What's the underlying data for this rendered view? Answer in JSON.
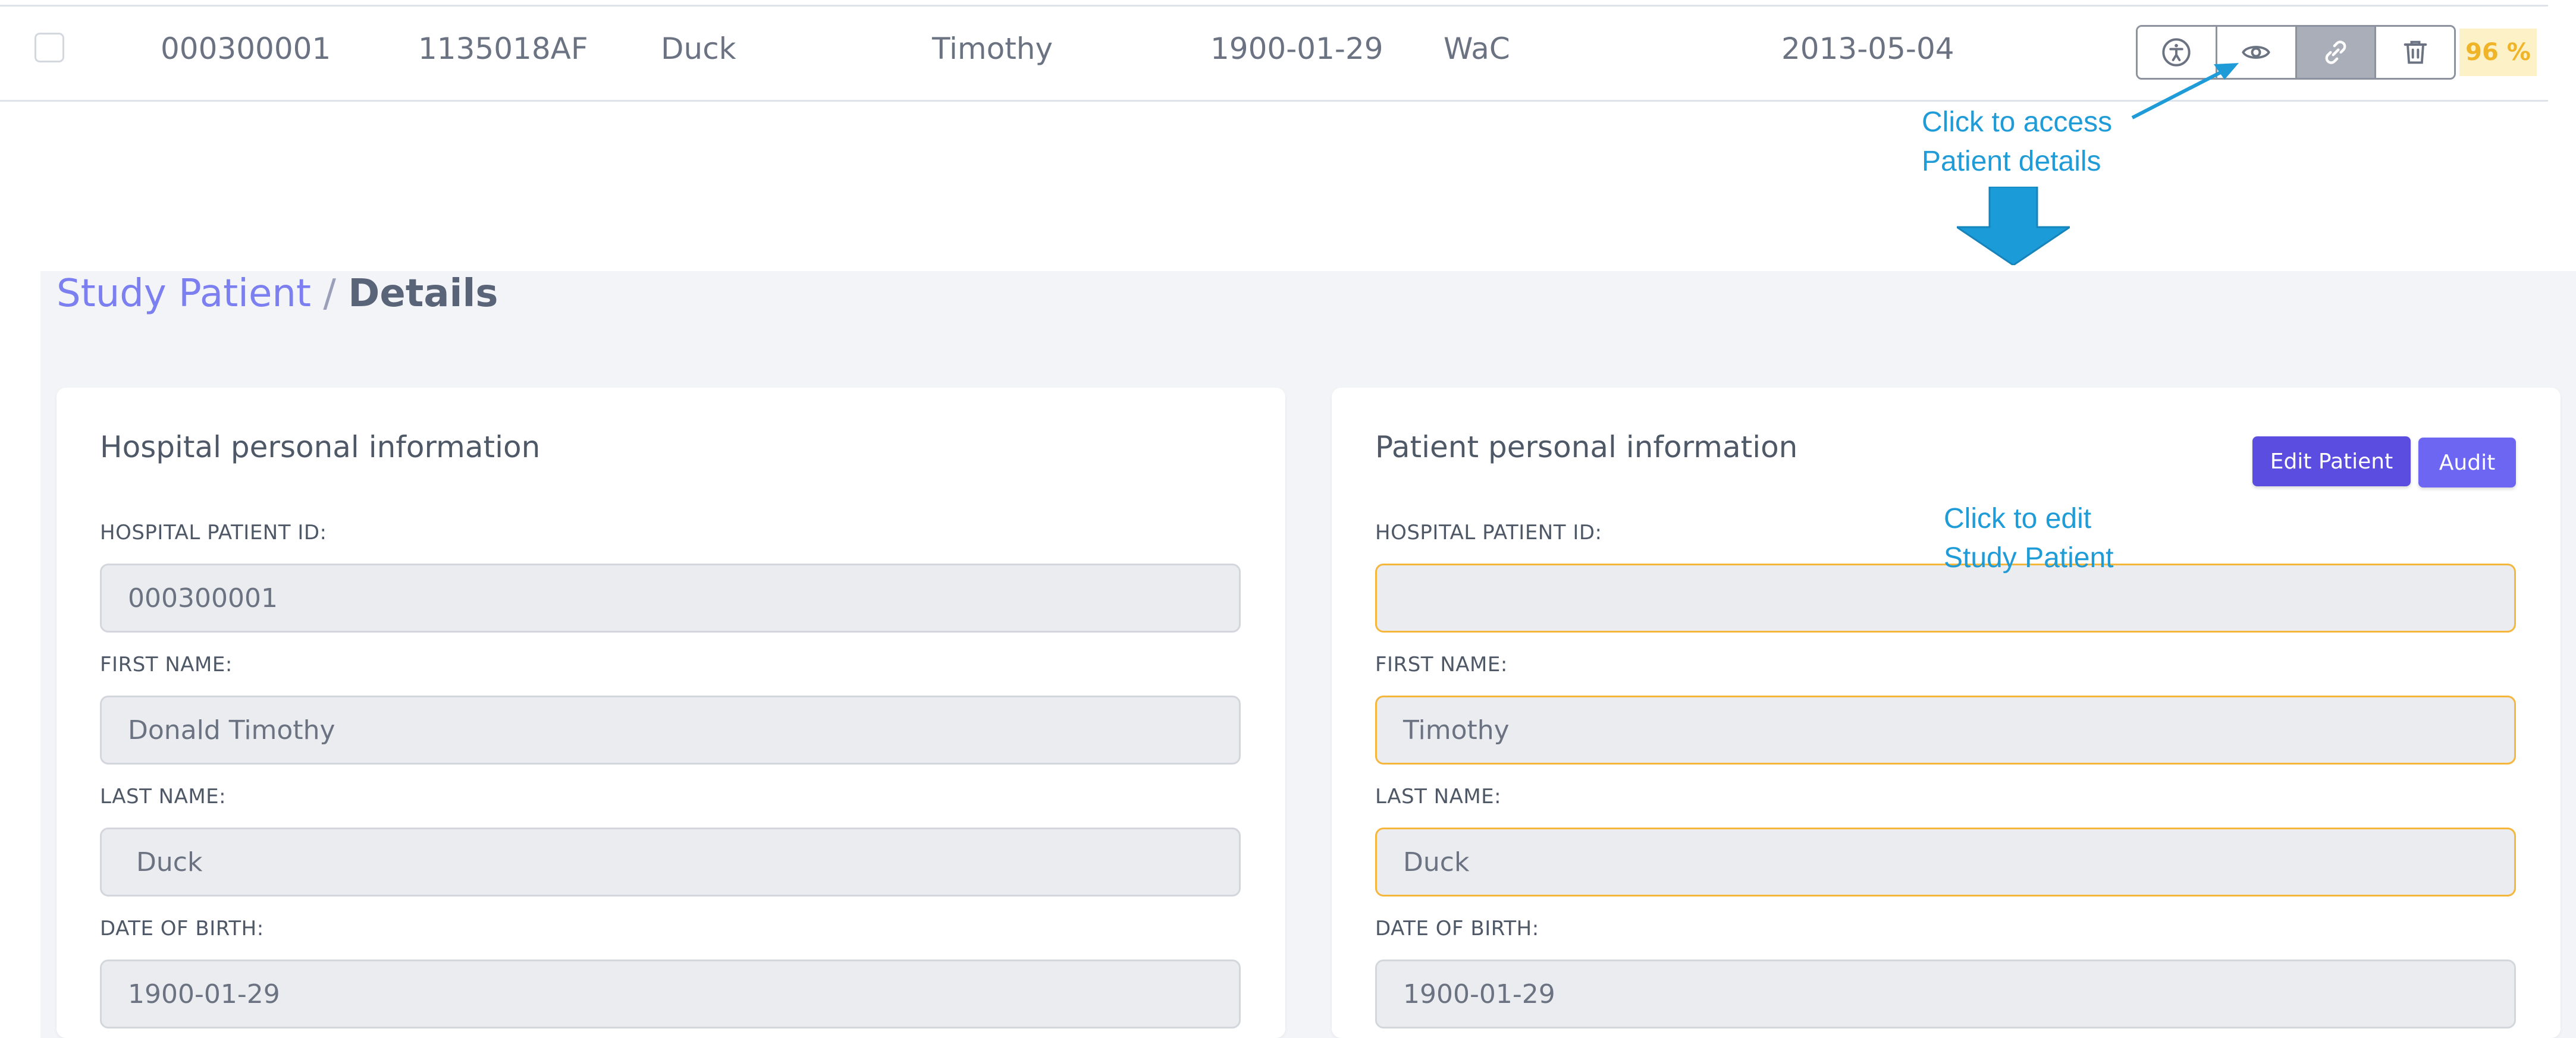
{
  "table_row": {
    "hospital_patient_id": "000300001",
    "study_id": "1135018AF",
    "last_name": "Duck",
    "first_name": "Timothy",
    "date_of_birth": "1900-01-29",
    "site": "WaC",
    "date": "2013-05-04",
    "actions": [
      "accessibility-icon",
      "eye-icon",
      "link-icon",
      "trash-icon"
    ],
    "score": "96 %"
  },
  "annotations": {
    "access_line1": "Click to access",
    "access_line2": "Patient details",
    "edit_line1": "Click to edit",
    "edit_line2": "Study Patient"
  },
  "breadcrumb": {
    "parent": "Study Patient",
    "separator": "/",
    "current": "Details"
  },
  "hospital_card": {
    "title": "Hospital personal information",
    "fields": [
      {
        "label": "HOSPITAL PATIENT ID:",
        "value": "000300001"
      },
      {
        "label": "FIRST NAME:",
        "value": "Donald Timothy"
      },
      {
        "label": "LAST NAME:",
        "value": " Duck"
      },
      {
        "label": "DATE OF BIRTH:",
        "value": "1900-01-29"
      }
    ]
  },
  "patient_card": {
    "title": "Patient personal information",
    "edit_button": "Edit Patient",
    "audit_button": "Audit",
    "fields": [
      {
        "label": "HOSPITAL PATIENT ID:",
        "value": ""
      },
      {
        "label": "FIRST NAME:",
        "value": "Timothy"
      },
      {
        "label": "LAST NAME:",
        "value": "Duck"
      },
      {
        "label": "DATE OF BIRTH:",
        "value": "1900-01-29"
      }
    ]
  },
  "colors": {
    "accent": "#5b4de0",
    "annotation": "#1f9cd8",
    "highlight_border": "#f4b73c",
    "score_text": "#f0b428"
  }
}
